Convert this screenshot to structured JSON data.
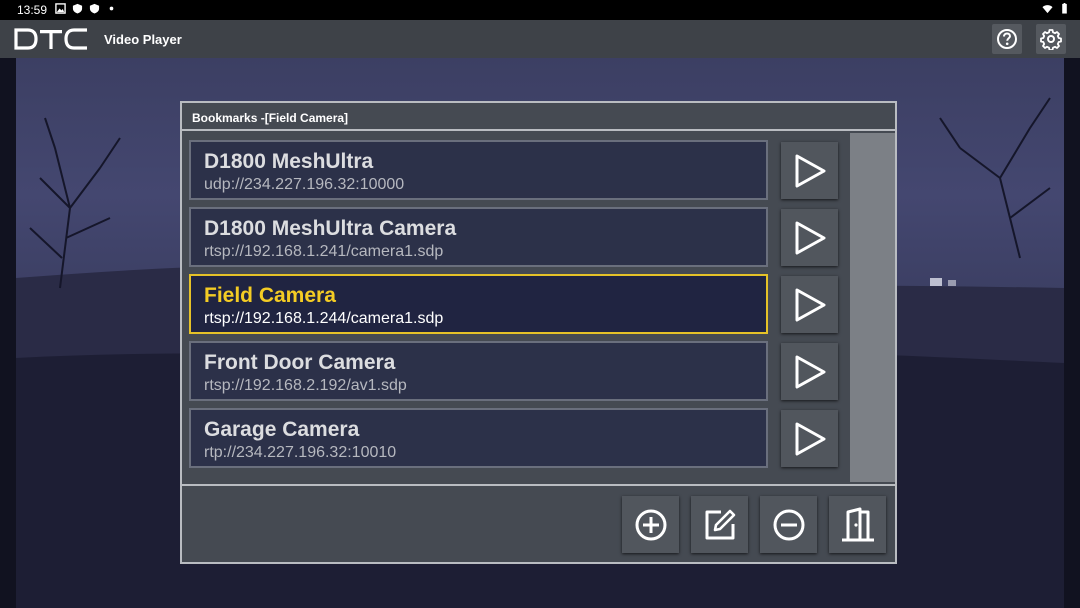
{
  "status_bar": {
    "time": "13:59"
  },
  "app_bar": {
    "logo_text": "DTC",
    "title": "Video Player",
    "help_icon": "help-icon",
    "settings_icon": "gear-icon"
  },
  "panel": {
    "header": "Bookmarks -[Field Camera]",
    "items": [
      {
        "name": "D1800 MeshUltra",
        "url": "udp://234.227.196.32:10000",
        "selected": false
      },
      {
        "name": "D1800 MeshUltra Camera",
        "url": "rtsp://192.168.1.241/camera1.sdp",
        "selected": false
      },
      {
        "name": "Field Camera",
        "url": "rtsp://192.168.1.244/camera1.sdp",
        "selected": true
      },
      {
        "name": "Front Door Camera",
        "url": "rtsp://192.168.2.192/av1.sdp",
        "selected": false
      },
      {
        "name": "Garage Camera",
        "url": "rtp://234.227.196.32:10010",
        "selected": false
      }
    ],
    "actions": [
      "add-icon",
      "edit-icon",
      "remove-icon",
      "exit-door-icon"
    ]
  },
  "colors": {
    "selected_accent": "#e5c228",
    "panel_bg": "#454a52",
    "appbar_bg": "#3e4248"
  }
}
